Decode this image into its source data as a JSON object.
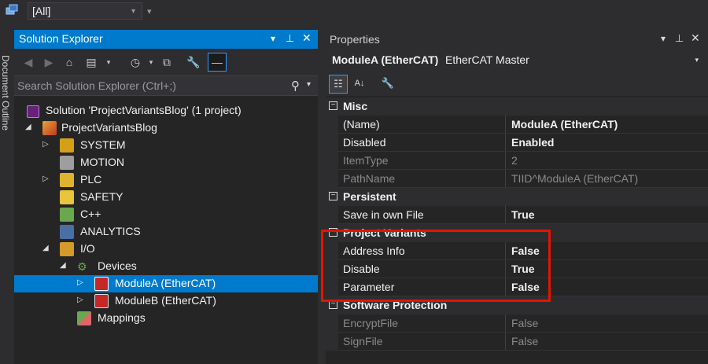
{
  "top_bar": {
    "configuration_value": "[All]"
  },
  "document_outline": {
    "label": "Document Outline"
  },
  "solution_explorer": {
    "title": "Solution Explorer",
    "search_placeholder": "Search Solution Explorer (Ctrl+;)",
    "tree": [
      {
        "label": "Solution 'ProjectVariantsBlog' (1 project)",
        "icon": "solution-icon"
      },
      {
        "label": "ProjectVariantsBlog",
        "icon": "project-icon"
      },
      {
        "label": "SYSTEM",
        "icon": "system-icon"
      },
      {
        "label": "MOTION",
        "icon": "motion-icon"
      },
      {
        "label": "PLC",
        "icon": "plc-icon"
      },
      {
        "label": "SAFETY",
        "icon": "safety-icon"
      },
      {
        "label": "C++",
        "icon": "cpp-icon"
      },
      {
        "label": "ANALYTICS",
        "icon": "analytics-icon"
      },
      {
        "label": "I/O",
        "icon": "io-icon"
      },
      {
        "label": "Devices",
        "icon": "devices-icon"
      },
      {
        "label": "ModuleA (EtherCAT)",
        "icon": "ethercat-icon"
      },
      {
        "label": "ModuleB (EtherCAT)",
        "icon": "ethercat-icon"
      },
      {
        "label": "Mappings",
        "icon": "mappings-icon"
      }
    ]
  },
  "properties": {
    "title": "Properties",
    "object_name": "ModuleA (EtherCAT)",
    "object_type": "EtherCAT Master",
    "categories": [
      {
        "label": "Misc"
      },
      {
        "label": "Persistent"
      },
      {
        "label": "Project Variants"
      },
      {
        "label": "Software Protection"
      }
    ],
    "rows": [
      {
        "name": "(Name)",
        "value": "ModuleA (EtherCAT)"
      },
      {
        "name": "Disabled",
        "value": "Enabled"
      },
      {
        "name": "ItemType",
        "value": "2"
      },
      {
        "name": "PathName",
        "value": "TIID^ModuleA (EtherCAT)"
      },
      {
        "name": "Save in own File",
        "value": "True"
      },
      {
        "name": "Address Info",
        "value": "False"
      },
      {
        "name": "Disable",
        "value": "True"
      },
      {
        "name": "Parameter",
        "value": "False"
      },
      {
        "name": "EncryptFile",
        "value": "False"
      },
      {
        "name": "SignFile",
        "value": "False"
      }
    ]
  },
  "colors": {
    "accent": "#007acc",
    "highlight": "#e51400",
    "background": "#252526"
  }
}
